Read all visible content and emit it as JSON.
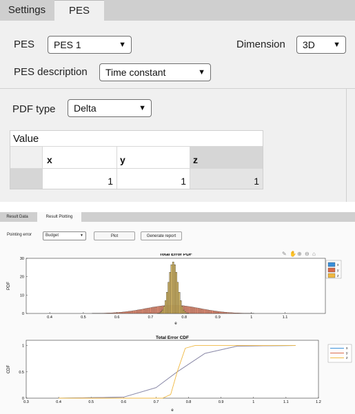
{
  "top_tabs": [
    {
      "label": "Settings",
      "active": false
    },
    {
      "label": "PES",
      "active": true
    }
  ],
  "pes": {
    "label": "PES",
    "value": "PES 1",
    "dimension_label": "Dimension",
    "dimension_value": "3D",
    "description_label": "PES description",
    "description_value": "Time constant"
  },
  "pdf": {
    "label": "PDF type",
    "value": "Delta"
  },
  "value_table": {
    "title": "Value",
    "columns": [
      "x",
      "y",
      "z"
    ],
    "rows": [
      [
        "1",
        "1",
        "1"
      ]
    ]
  },
  "bottom_tabs": [
    {
      "label": "Result Data",
      "active": false
    },
    {
      "label": "Result Plotting",
      "active": true
    }
  ],
  "controls": {
    "pointing_error_label": "Pointing error",
    "pointing_error_value": "Budget",
    "plot_button": "Plot",
    "report_button": "Generate report"
  },
  "icons": [
    "brush-icon",
    "pan-hand-icon",
    "zoom-in-icon",
    "zoom-out-icon",
    "home-icon"
  ],
  "colors": {
    "x": "#3a8fd9",
    "y": "#d96a4a",
    "z": "#f0b840",
    "panel_bg": "#f0f0f0",
    "tab_bar": "#cfcfcf"
  },
  "chart_data": [
    {
      "type": "bar",
      "title": "Total Error PDF",
      "xlabel": "e",
      "ylabel": "PDF",
      "xlim": [
        0.33,
        1.22
      ],
      "ylim": [
        0,
        30
      ],
      "xticks": [
        "0.4",
        "0.5",
        "0.6",
        "0.7",
        "0.8",
        "0.9",
        "1",
        "1.1"
      ],
      "yticks": [
        "0",
        "10",
        "20",
        "30"
      ],
      "legend": "top-right",
      "series": [
        {
          "name": "x",
          "distribution": "normal",
          "mean": 0.765,
          "std": 0.0135,
          "peak": 28
        },
        {
          "name": "y",
          "distribution": "normal",
          "mean": 0.765,
          "std": 0.08,
          "peak": 4.5
        },
        {
          "name": "z",
          "distribution": "normal",
          "mean": 0.765,
          "std": 0.0135,
          "peak": 28
        }
      ]
    },
    {
      "type": "line",
      "title": "Total Error CDF",
      "xlabel": "e",
      "ylabel": "CDF",
      "xlim": [
        0.3,
        1.2
      ],
      "ylim": [
        0,
        1.1
      ],
      "xticks": [
        "0.3",
        "0.4",
        "0.5",
        "0.6",
        "0.7",
        "0.8",
        "0.9",
        "1",
        "1.1",
        "1.2"
      ],
      "yticks": [
        "0",
        "0.5",
        "1"
      ],
      "legend": "top-right",
      "series": [
        {
          "name": "x",
          "x": [
            0.4,
            0.6,
            0.7,
            0.765,
            0.85,
            0.95,
            1.13
          ],
          "y": [
            0,
            0.02,
            0.2,
            0.5,
            0.85,
            0.99,
            1
          ]
        },
        {
          "name": "y",
          "x": [
            0.4,
            0.6,
            0.7,
            0.765,
            0.85,
            0.95,
            1.13
          ],
          "y": [
            0,
            0.02,
            0.2,
            0.5,
            0.85,
            0.99,
            1
          ]
        },
        {
          "name": "z",
          "x": [
            0.4,
            0.72,
            0.745,
            0.765,
            0.79,
            0.82,
            1.13
          ],
          "y": [
            0,
            0,
            0.07,
            0.5,
            0.95,
            1,
            1
          ]
        }
      ]
    }
  ]
}
